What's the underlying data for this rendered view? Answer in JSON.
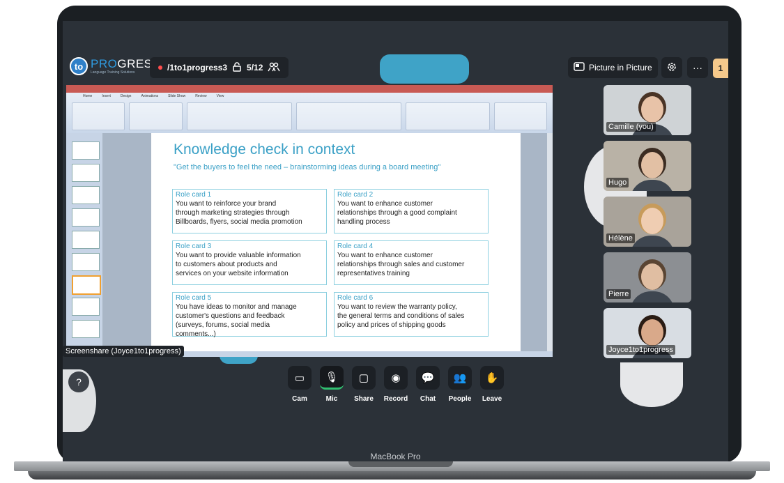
{
  "device": {
    "label": "MacBook Pro"
  },
  "header": {
    "logo_initials": "to",
    "logo_main_accent": "PRO",
    "logo_main_rest": "GRESS",
    "logo_sub": "Language Training Solutions",
    "room_name": "/1to1progress3",
    "lock_icon": "unlock-icon",
    "participant_count": "5/12",
    "people_icon": "people-icon",
    "pip_label": "Picture in Picture",
    "settings_icon": "gear-icon",
    "more_icon": "more-icon",
    "badge_count": "1"
  },
  "share": {
    "label": "Screenshare (Joyce1to1progress)",
    "ribbon_tabs": [
      "Home",
      "Insert",
      "Design",
      "Animations",
      "Slide Show",
      "Review",
      "View"
    ],
    "slide": {
      "title": "Knowledge check in context",
      "subtitle": "\"Get the buyers to feel the need – brainstorming ideas during a board meeting\"",
      "cards": [
        {
          "title": "Role card 1",
          "lines": [
            "You want to reinforce your brand",
            "through marketing strategies through",
            "Billboards, flyers, social media promotion"
          ]
        },
        {
          "title": "Role card 2",
          "lines": [
            "You want to enhance customer",
            "relationships through a good complaint",
            "handling process"
          ]
        },
        {
          "title": "Role card 3",
          "lines": [
            "You want to provide valuable information",
            "to customers about products and",
            "services on your website information"
          ]
        },
        {
          "title": "Role card 4",
          "lines": [
            "You want to enhance customer",
            "relationships through sales and customer",
            "representatives training"
          ]
        },
        {
          "title": "Role card 5",
          "lines": [
            "You have ideas to monitor and manage",
            "customer's questions and feedback",
            "(surveys, forums, social media",
            "comments...)"
          ]
        },
        {
          "title": "Role card 6",
          "lines": [
            "You want to review the warranty policy,",
            "the general terms and conditions of sales",
            "policy and prices of shipping goods"
          ]
        }
      ]
    }
  },
  "participants": [
    {
      "name": "Camille (you)",
      "bg": "#cfd3d6",
      "skin": "#e8c3a8",
      "hair": "#4a3426"
    },
    {
      "name": "Hugo",
      "bg": "#b9b2a6",
      "skin": "#e2c0a4",
      "hair": "#3b2c22"
    },
    {
      "name": "Hélène",
      "bg": "#a9a39a",
      "skin": "#efcdb2",
      "hair": "#c79b5b"
    },
    {
      "name": "Pierre",
      "bg": "#8c8f93",
      "skin": "#e0bea2",
      "hair": "#5a4533"
    },
    {
      "name": "Joyce1to1progress",
      "bg": "#d8dde3",
      "skin": "#d9a98a",
      "hair": "#2a1c14"
    }
  ],
  "controls": [
    {
      "label": "Cam",
      "icon": "camera-icon",
      "glyph": "▭"
    },
    {
      "label": "Mic",
      "icon": "mic-icon",
      "glyph": "🎙"
    },
    {
      "label": "Share",
      "icon": "share-screen-icon",
      "glyph": "▢"
    },
    {
      "label": "Record",
      "icon": "record-icon",
      "glyph": "◉"
    },
    {
      "label": "Chat",
      "icon": "chat-icon",
      "glyph": "💬"
    },
    {
      "label": "People",
      "icon": "people-icon",
      "glyph": "👥"
    },
    {
      "label": "Leave",
      "icon": "leave-hand-icon",
      "glyph": "✋"
    }
  ],
  "help": {
    "glyph": "?"
  }
}
